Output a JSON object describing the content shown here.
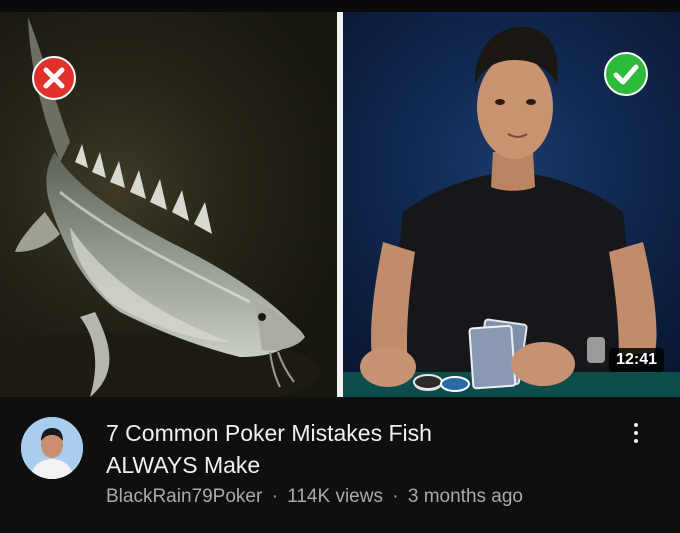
{
  "video": {
    "duration": "12:41",
    "title_line1": "7 Common Poker Mistakes Fish",
    "title_line2": "ALWAYS Make",
    "channel": "BlackRain79Poker",
    "views": "114K views",
    "age": "3 months ago",
    "separator": "·"
  },
  "thumbnail": {
    "left_image": "sturgeon-fish",
    "right_image": "man-holding-poker-cards",
    "left_badge": "x-mark-icon",
    "right_badge": "check-mark-icon"
  },
  "colors": {
    "background": "#0f0f0f",
    "badge_bad": "#e0312d",
    "badge_good": "#2dbb3a",
    "subtitle_text": "#aaaaaa"
  }
}
